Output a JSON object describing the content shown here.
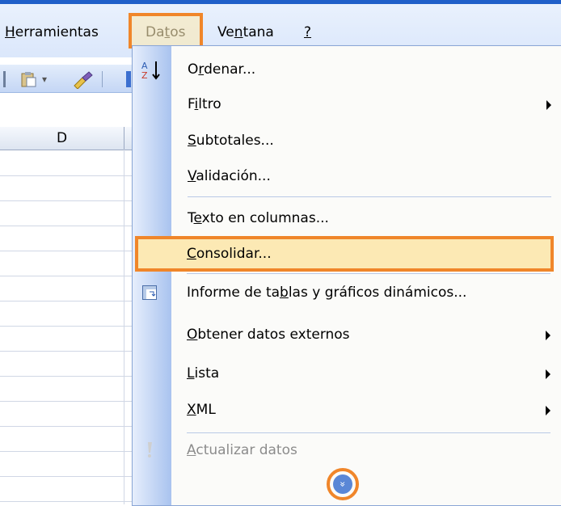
{
  "menubar": {
    "items": [
      {
        "label": "Herramientas",
        "mnemonic_index": 0
      },
      {
        "label": "Datos",
        "mnemonic_index": 2
      },
      {
        "label": "Ventana",
        "mnemonic_index": 2
      },
      {
        "label": "?",
        "mnemonic_index": 0
      }
    ]
  },
  "sheet": {
    "column_header": "D"
  },
  "datos_menu": {
    "items": [
      {
        "label": "Ordenar...",
        "mnemonic_index": 1,
        "icon": "sort-az-icon",
        "submenu": false,
        "enabled": true
      },
      {
        "label": "Filtro",
        "mnemonic_index": 1,
        "submenu": true,
        "enabled": true
      },
      {
        "label": "Subtotales...",
        "mnemonic_index": 0,
        "submenu": false,
        "enabled": true
      },
      {
        "label": "Validación...",
        "mnemonic_index": 0,
        "submenu": false,
        "enabled": true
      },
      {
        "label": "Texto en columnas...",
        "mnemonic_index": 1,
        "submenu": false,
        "enabled": true
      },
      {
        "label": "Consolidar...",
        "mnemonic_index": 0,
        "submenu": false,
        "enabled": true,
        "highlighted": true
      },
      {
        "label": "Informe de tablas y gráficos dinámicos...",
        "mnemonic_index": 13,
        "icon": "pivot-table-icon",
        "submenu": false,
        "enabled": true
      },
      {
        "label": "Obtener datos externos",
        "mnemonic_index": 0,
        "submenu": true,
        "enabled": true
      },
      {
        "label": "Lista",
        "mnemonic_index": 0,
        "submenu": true,
        "enabled": true
      },
      {
        "label": "XML",
        "mnemonic_index": 0,
        "submenu": true,
        "enabled": true
      },
      {
        "label": "Actualizar datos",
        "mnemonic_index": 0,
        "icon": "refresh-data-icon",
        "submenu": false,
        "enabled": false
      }
    ],
    "expand_glyph": "»"
  },
  "colors": {
    "highlight_border": "#f0862a",
    "highlight_fill": "#fce9b4",
    "menu_strip": "#a9c3ef",
    "title_line": "#1f5fc9"
  }
}
